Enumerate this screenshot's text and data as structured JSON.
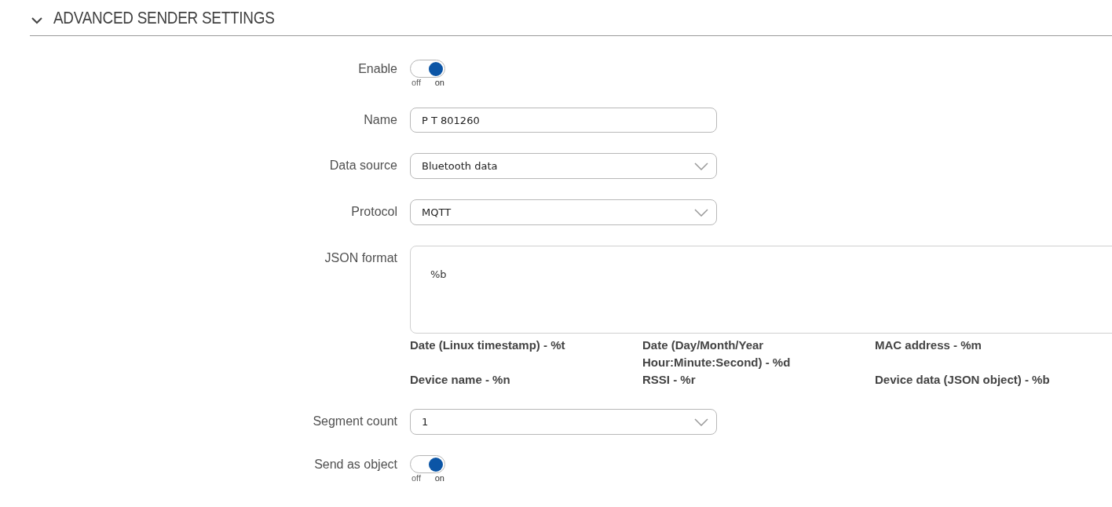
{
  "section": {
    "title": "ADVANCED SENDER SETTINGS",
    "expanded": true
  },
  "fields": [
    {
      "kind": "toggle",
      "label": "Enable",
      "on": true,
      "off_text": "off",
      "on_text": "on"
    },
    {
      "kind": "text",
      "label": "Name",
      "value": "P T 801260"
    },
    {
      "kind": "select",
      "label": "Data source",
      "value": "Bluetooth data"
    },
    {
      "kind": "select",
      "label": "Protocol",
      "value": "MQTT"
    },
    {
      "kind": "textarea",
      "label": "JSON format",
      "value": "%b",
      "hints": [
        "Date (Linux timestamp) - %t",
        "Date (Day/Month/Year Hour:Minute:Second) - %d",
        "MAC address - %m",
        "Device name - %n",
        "RSSI - %r",
        "Device data (JSON object) - %b"
      ]
    },
    {
      "kind": "select",
      "label": "Segment count",
      "value": "1"
    },
    {
      "kind": "toggle",
      "label": "Send as object",
      "on": true,
      "off_text": "off",
      "on_text": "on"
    }
  ]
}
